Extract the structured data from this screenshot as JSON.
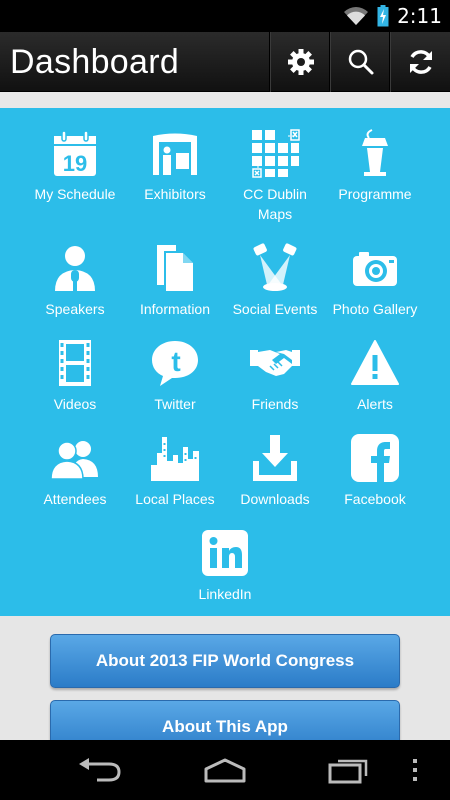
{
  "status": {
    "time": "2:11"
  },
  "header": {
    "title": "Dashboard"
  },
  "grid": {
    "items": [
      {
        "label": "My Schedule",
        "icon": "calendar-icon",
        "date": "19"
      },
      {
        "label": "Exhibitors",
        "icon": "exhibitor-booth-icon"
      },
      {
        "label": "CC Dublin\nMaps",
        "icon": "floor-map-icon"
      },
      {
        "label": "Programme",
        "icon": "lectern-icon"
      },
      {
        "label": "Speakers",
        "icon": "speaker-person-icon"
      },
      {
        "label": "Information",
        "icon": "documents-icon"
      },
      {
        "label": "Social Events",
        "icon": "spotlights-icon"
      },
      {
        "label": "Photo Gallery",
        "icon": "camera-icon"
      },
      {
        "label": "Videos",
        "icon": "film-strip-icon"
      },
      {
        "label": "Twitter",
        "icon": "twitter-icon"
      },
      {
        "label": "Friends",
        "icon": "handshake-icon"
      },
      {
        "label": "Alerts",
        "icon": "warning-icon"
      },
      {
        "label": "Attendees",
        "icon": "people-icon"
      },
      {
        "label": "Local Places",
        "icon": "city-skyline-icon"
      },
      {
        "label": "Downloads",
        "icon": "download-icon"
      },
      {
        "label": "Facebook",
        "icon": "facebook-icon"
      },
      {
        "label": "LinkedIn",
        "icon": "linkedin-icon"
      }
    ]
  },
  "buttons": {
    "about_congress": "About 2013 FIP World Congress",
    "about_app": "About This App"
  },
  "colors": {
    "panel": "#2cbde9",
    "button": "#3d8fd6",
    "actionbar": "#1c1c1c"
  }
}
